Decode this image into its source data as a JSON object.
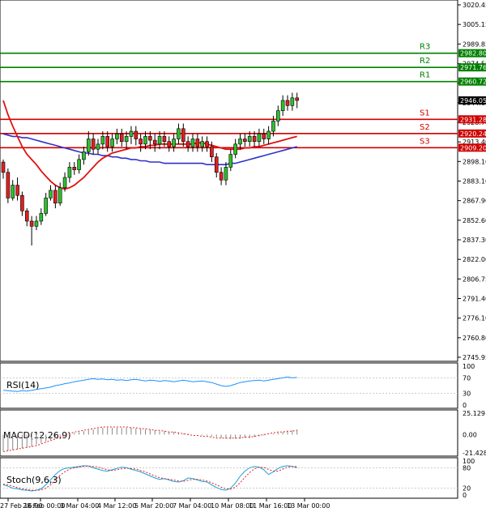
{
  "chart_data": {
    "type": "candlestick",
    "main": {
      "ylim": [
        2745.95,
        3020.45
      ],
      "y_ticks": [
        "3020.45",
        "3005.15",
        "2989.85",
        "2974.55",
        "2959.25",
        "2944.00",
        "2928.70",
        "2913.40",
        "2898.10",
        "2883.10",
        "2867.90",
        "2852.60",
        "2837.30",
        "2822.00",
        "2806.75",
        "2791.40",
        "2776.10",
        "2760.80",
        "2745.95"
      ],
      "current_price": {
        "value": 2946.05,
        "label": "2946.05"
      },
      "levels": [
        {
          "name": "R3",
          "value": 2982.8,
          "label": "2982.80",
          "color": "#008000"
        },
        {
          "name": "R2",
          "value": 2971.76,
          "label": "2971.76",
          "color": "#008000"
        },
        {
          "name": "R1",
          "value": 2960.72,
          "label": "2960.72",
          "color": "#008000"
        },
        {
          "name": "S1",
          "value": 2931.28,
          "label": "2931.28",
          "color": "#d00000"
        },
        {
          "name": "S2",
          "value": 2920.24,
          "label": "2920.24",
          "color": "#d00000"
        },
        {
          "name": "S3",
          "value": 2909.2,
          "label": "2909.20",
          "color": "#d00000"
        }
      ],
      "candles": [
        [
          2898,
          2890,
          2900,
          2885
        ],
        [
          2890,
          2870,
          2893,
          2866
        ],
        [
          2870,
          2880,
          2884,
          2868
        ],
        [
          2880,
          2872,
          2886,
          2868
        ],
        [
          2872,
          2860,
          2875,
          2856
        ],
        [
          2860,
          2852,
          2862,
          2848
        ],
        [
          2852,
          2848,
          2856,
          2833
        ],
        [
          2848,
          2852,
          2856,
          2845
        ],
        [
          2852,
          2858,
          2862,
          2849
        ],
        [
          2858,
          2870,
          2874,
          2856
        ],
        [
          2870,
          2876,
          2880,
          2868
        ],
        [
          2876,
          2866,
          2880,
          2862
        ],
        [
          2866,
          2878,
          2882,
          2864
        ],
        [
          2878,
          2886,
          2890,
          2875
        ],
        [
          2886,
          2894,
          2898,
          2882
        ],
        [
          2894,
          2892,
          2898,
          2888
        ],
        [
          2892,
          2900,
          2904,
          2889
        ],
        [
          2900,
          2906,
          2910,
          2896
        ],
        [
          2906,
          2916,
          2922,
          2903
        ],
        [
          2916,
          2908,
          2920,
          2904
        ],
        [
          2908,
          2912,
          2916,
          2904
        ],
        [
          2912,
          2918,
          2922,
          2908
        ],
        [
          2918,
          2910,
          2922,
          2906
        ],
        [
          2910,
          2916,
          2920,
          2906
        ],
        [
          2916,
          2920,
          2924,
          2912
        ],
        [
          2920,
          2914,
          2924,
          2910
        ],
        [
          2914,
          2918,
          2922,
          2908
        ],
        [
          2918,
          2922,
          2926,
          2912
        ],
        [
          2922,
          2916,
          2926,
          2911
        ],
        [
          2916,
          2912,
          2920,
          2906
        ],
        [
          2912,
          2918,
          2922,
          2908
        ],
        [
          2918,
          2915,
          2922,
          2908
        ],
        [
          2915,
          2912,
          2920,
          2906
        ],
        [
          2912,
          2918,
          2922,
          2908
        ],
        [
          2918,
          2914,
          2922,
          2910
        ],
        [
          2914,
          2910,
          2918,
          2906
        ],
        [
          2910,
          2916,
          2920,
          2906
        ],
        [
          2916,
          2924,
          2928,
          2912
        ],
        [
          2924,
          2914,
          2928,
          2910
        ],
        [
          2914,
          2910,
          2918,
          2906
        ],
        [
          2910,
          2916,
          2920,
          2906
        ],
        [
          2916,
          2910,
          2920,
          2906
        ],
        [
          2910,
          2914,
          2918,
          2906
        ],
        [
          2914,
          2910,
          2918,
          2906
        ],
        [
          2910,
          2902,
          2914,
          2898
        ],
        [
          2902,
          2890,
          2905,
          2886
        ],
        [
          2890,
          2884,
          2894,
          2880
        ],
        [
          2884,
          2894,
          2898,
          2880
        ],
        [
          2894,
          2904,
          2908,
          2891
        ],
        [
          2904,
          2912,
          2916,
          2901
        ],
        [
          2912,
          2916,
          2920,
          2908
        ],
        [
          2916,
          2914,
          2920,
          2910
        ],
        [
          2914,
          2918,
          2922,
          2910
        ],
        [
          2918,
          2914,
          2922,
          2910
        ],
        [
          2914,
          2920,
          2924,
          2910
        ],
        [
          2920,
          2916,
          2924,
          2912
        ],
        [
          2916,
          2922,
          2926,
          2912
        ],
        [
          2922,
          2930,
          2934,
          2918
        ],
        [
          2930,
          2938,
          2942,
          2926
        ],
        [
          2938,
          2946,
          2950,
          2934
        ],
        [
          2946,
          2942,
          2950,
          2938
        ],
        [
          2942,
          2948,
          2952,
          2938
        ],
        [
          2948,
          2946,
          2952,
          2940
        ]
      ],
      "ma_red": [
        2946,
        2935,
        2926,
        2918,
        2910,
        2904,
        2900,
        2896,
        2891,
        2887,
        2883,
        2880,
        2878,
        2877,
        2878,
        2880,
        2883,
        2886,
        2890,
        2894,
        2898,
        2901,
        2903,
        2905,
        2906,
        2907,
        2908,
        2909,
        2909,
        2910,
        2910,
        2911,
        2911,
        2912,
        2912,
        2912,
        2912,
        2912,
        2912,
        2912,
        2912,
        2913,
        2913,
        2912,
        2911,
        2910,
        2909,
        2908,
        2908,
        2908,
        2908,
        2909,
        2909,
        2910,
        2910,
        2911,
        2912,
        2913,
        2914,
        2915,
        2916,
        2917,
        2918
      ],
      "ma_blue": [
        2920,
        2919,
        2918,
        2918,
        2917,
        2917,
        2916,
        2915,
        2914,
        2913,
        2912,
        2911,
        2910,
        2909,
        2908,
        2907,
        2906,
        2905,
        2905,
        2904,
        2904,
        2903,
        2903,
        2902,
        2902,
        2901,
        2901,
        2900,
        2900,
        2899,
        2899,
        2898,
        2898,
        2898,
        2897,
        2897,
        2897,
        2897,
        2897,
        2897,
        2897,
        2897,
        2897,
        2896,
        2896,
        2896,
        2896,
        2896,
        2897,
        2897,
        2898,
        2899,
        2900,
        2901,
        2902,
        2903,
        2904,
        2905,
        2906,
        2907,
        2908,
        2909,
        2910
      ]
    },
    "x_labels": [
      "27 Feb 16:00",
      "28 Feb 00:00",
      "3 Mar 04:00",
      "4 Mar 12:00",
      "5 Mar 20:00",
      "7 Mar 04:00",
      "10 Mar 08:00",
      "11 Mar 16:00",
      "13 Mar 00:00"
    ],
    "rsi": {
      "label": "RSI(14)",
      "ylim": [
        0,
        100
      ],
      "ticks": [
        "100",
        "70",
        "30",
        "0"
      ],
      "levels": [
        70,
        30
      ],
      "values": [
        38,
        37,
        36,
        35,
        37,
        36,
        38,
        40,
        42,
        44,
        46,
        50,
        52,
        55,
        57,
        60,
        62,
        64,
        66,
        68,
        66,
        67,
        65,
        66,
        64,
        65,
        63,
        65,
        66,
        64,
        62,
        64,
        63,
        61,
        63,
        62,
        60,
        62,
        64,
        62,
        60,
        61,
        62,
        60,
        58,
        54,
        50,
        48,
        50,
        54,
        58,
        60,
        62,
        63,
        64,
        62,
        64,
        66,
        68,
        70,
        72,
        70,
        71
      ]
    },
    "macd": {
      "label": "MACD(12,26,9)",
      "ticks": [
        "25.129",
        "0.00",
        "-21.428"
      ],
      "ylim": [
        -21.428,
        25.129
      ],
      "hist": [
        -19,
        -19,
        -18,
        -17,
        -16,
        -15,
        -14,
        -12,
        -10,
        -8,
        -6,
        -4,
        -2,
        0,
        1,
        2,
        3,
        4,
        5,
        6,
        7,
        8,
        8,
        8,
        8,
        8,
        8,
        8,
        7,
        7,
        6,
        6,
        5,
        4,
        4,
        3,
        3,
        2,
        1,
        1,
        0,
        0,
        -1,
        -1,
        -2,
        -3,
        -4,
        -5,
        -5,
        -5,
        -5,
        -4,
        -4,
        -3,
        -2,
        -1,
        0,
        1,
        2,
        3,
        4,
        5,
        6
      ],
      "signal": [
        -20,
        -19,
        -18,
        -17,
        -16,
        -15,
        -14,
        -13,
        -11,
        -9,
        -7,
        -5,
        -3,
        -1,
        1,
        3,
        4,
        5,
        6,
        7,
        8,
        9,
        9,
        9,
        9,
        9,
        9,
        8,
        8,
        7,
        7,
        6,
        5,
        5,
        4,
        3,
        3,
        2,
        1,
        0,
        -1,
        -1,
        -2,
        -2,
        -3,
        -4,
        -4,
        -4,
        -4,
        -4,
        -4,
        -3,
        -3,
        -2,
        -1,
        0,
        1,
        2,
        3,
        3,
        4,
        4,
        5
      ]
    },
    "stoch": {
      "label": "Stoch(9,6,3)",
      "ylim": [
        0,
        100
      ],
      "ticks": [
        "100",
        "80",
        "20",
        "0"
      ],
      "levels": [
        80,
        20
      ],
      "k": [
        30,
        26,
        20,
        18,
        15,
        14,
        12,
        14,
        18,
        30,
        45,
        60,
        72,
        78,
        80,
        82,
        84,
        86,
        85,
        80,
        76,
        72,
        70,
        74,
        78,
        82,
        80,
        76,
        72,
        68,
        62,
        56,
        50,
        46,
        48,
        44,
        40,
        38,
        42,
        50,
        48,
        44,
        40,
        38,
        30,
        22,
        16,
        14,
        20,
        35,
        55,
        70,
        80,
        84,
        82,
        74,
        60,
        68,
        78,
        84,
        86,
        84,
        80
      ],
      "d": [
        32,
        30,
        26,
        22,
        18,
        16,
        14,
        14,
        15,
        20,
        30,
        45,
        58,
        68,
        76,
        80,
        82,
        84,
        85,
        84,
        82,
        78,
        74,
        72,
        74,
        77,
        79,
        78,
        76,
        72,
        68,
        62,
        56,
        51,
        48,
        46,
        44,
        41,
        40,
        43,
        46,
        46,
        44,
        41,
        36,
        30,
        23,
        18,
        17,
        23,
        36,
        52,
        66,
        77,
        82,
        81,
        75,
        70,
        70,
        76,
        82,
        84,
        83
      ]
    }
  }
}
